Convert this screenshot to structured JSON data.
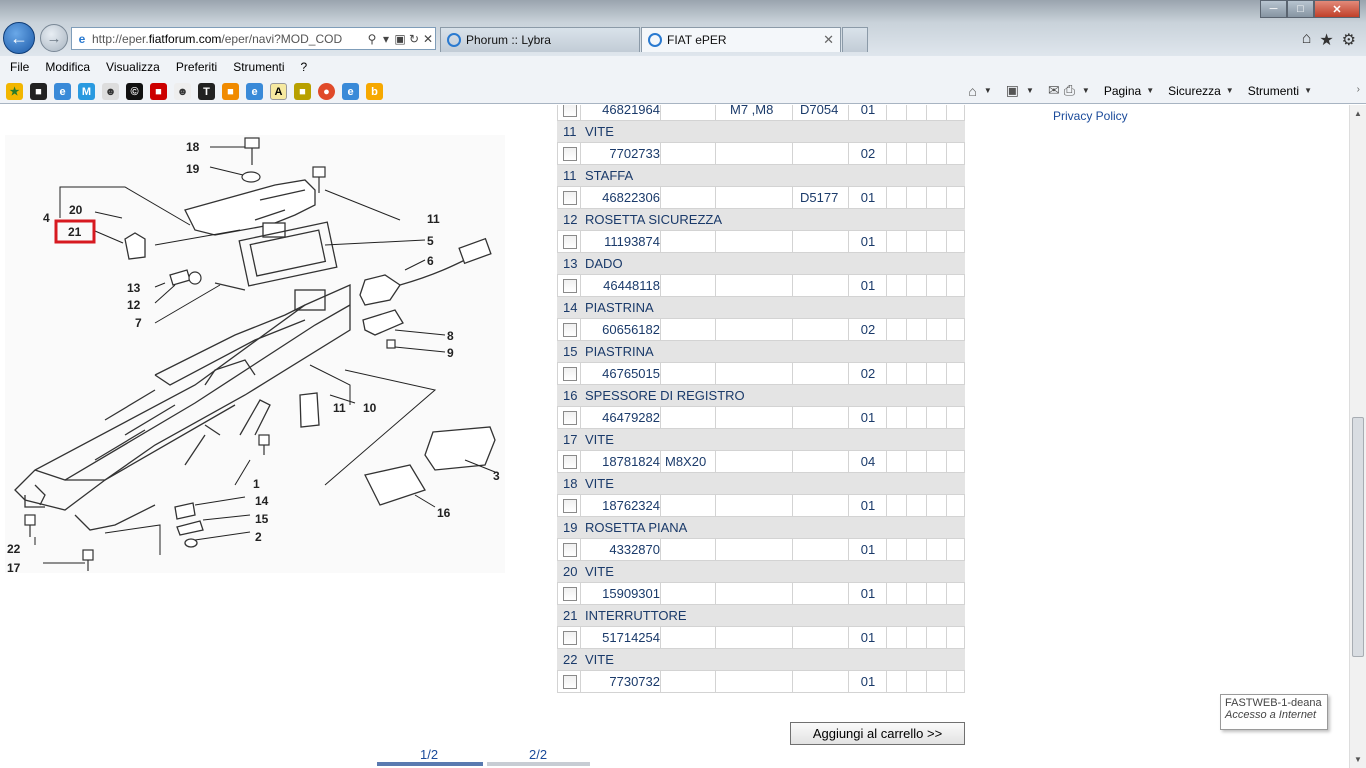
{
  "browser": {
    "address": {
      "prefix": "http://eper.",
      "domain": "fiatforum.com",
      "suffix": "/eper/navi?MOD_COD"
    },
    "tabs": [
      {
        "label": "Phorum :: Lybra",
        "active": false
      },
      {
        "label": "FIAT ePER",
        "active": true
      }
    ],
    "menu": [
      "File",
      "Modifica",
      "Visualizza",
      "Preferiti",
      "Strumenti",
      "?"
    ],
    "commands": [
      "Pagina",
      "Sicurezza",
      "Strumenti"
    ]
  },
  "diagram": {
    "callout_highlight": "21",
    "labels": [
      "18",
      "19",
      "20",
      "4",
      "21",
      "11",
      "5",
      "6",
      "13",
      "12",
      "7",
      "8",
      "9",
      "11",
      "10",
      "1",
      "3",
      "14",
      "15",
      "2",
      "16",
      "22",
      "17"
    ]
  },
  "privacy_link": "Privacy Policy",
  "table": {
    "top_partial": {
      "code": "46821964",
      "desc": "M7 ,M8",
      "note": "D7054",
      "qty": "01"
    },
    "items": [
      {
        "num": "11",
        "name": "VITE",
        "code": "7702733",
        "desc": "",
        "note": "",
        "qty": "02"
      },
      {
        "num": "11",
        "name": "STAFFA",
        "code": "46822306",
        "desc": "",
        "note": "D5177",
        "qty": "01"
      },
      {
        "num": "12",
        "name": "ROSETTA SICUREZZA",
        "code": "11193874",
        "desc": "",
        "note": "",
        "qty": "01"
      },
      {
        "num": "13",
        "name": "DADO",
        "code": "46448118",
        "desc": "",
        "note": "",
        "qty": "01"
      },
      {
        "num": "14",
        "name": "PIASTRINA",
        "code": "60656182",
        "desc": "",
        "note": "",
        "qty": "02"
      },
      {
        "num": "15",
        "name": "PIASTRINA",
        "code": "46765015",
        "desc": "",
        "note": "",
        "qty": "02"
      },
      {
        "num": "16",
        "name": "SPESSORE DI REGISTRO",
        "code": "46479282",
        "desc": "",
        "note": "",
        "qty": "01"
      },
      {
        "num": "17",
        "name": "VITE",
        "code": "18781824",
        "desc": "M8X20",
        "note": "",
        "qty": "04"
      },
      {
        "num": "18",
        "name": "VITE",
        "code": "18762324",
        "desc": "",
        "note": "",
        "qty": "01"
      },
      {
        "num": "19",
        "name": "ROSETTA PIANA",
        "code": "4332870",
        "desc": "",
        "note": "",
        "qty": "01"
      },
      {
        "num": "20",
        "name": "VITE",
        "code": "15909301",
        "desc": "",
        "note": "",
        "qty": "01"
      },
      {
        "num": "21",
        "name": "INTERRUTTORE",
        "code": "51714254",
        "desc": "",
        "note": "",
        "qty": "01"
      },
      {
        "num": "22",
        "name": "VITE",
        "code": "7730732",
        "desc": "",
        "note": "",
        "qty": "01"
      }
    ]
  },
  "cart_button": "Aggiungi al carrello >>",
  "pager": {
    "page1": "1/2",
    "page2": "2/2"
  },
  "tooltip": {
    "line1": "FASTWEB-1-deana",
    "line2": "Accesso a Internet"
  }
}
